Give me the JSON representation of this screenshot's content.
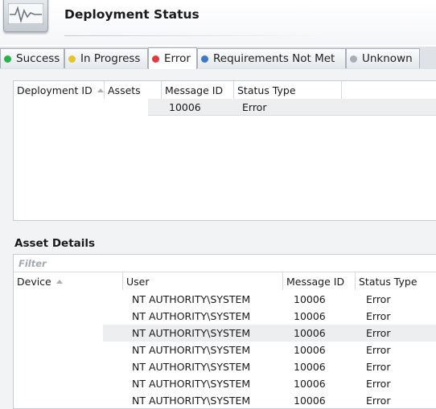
{
  "header": {
    "title": "Deployment Status",
    "icon": "activity-monitor-icon"
  },
  "tabs": [
    {
      "label": "Success",
      "color": "#2ab24a",
      "active": false
    },
    {
      "label": "In Progress",
      "color": "#e6c42b",
      "active": false
    },
    {
      "label": "Error",
      "color": "#e0393e",
      "active": true
    },
    {
      "label": "Requirements Not Met",
      "color": "#3b78c8",
      "active": false
    },
    {
      "label": "Unknown",
      "color": "#a9aeb3",
      "active": false
    }
  ],
  "deployments": {
    "columns": [
      "Deployment ID",
      "Assets",
      "Message ID",
      "Status Type"
    ],
    "sorted_column": "Deployment ID",
    "rows": [
      {
        "deployment_id": "",
        "assets": "",
        "message_id": "10006",
        "status_type": "Error"
      }
    ]
  },
  "asset_details": {
    "title": "Asset Details",
    "filter_placeholder": "Filter",
    "columns": [
      "Device",
      "User",
      "Message ID",
      "Status Type"
    ],
    "sorted_column": "Device",
    "selected_row": 2,
    "rows": [
      {
        "device": "",
        "user": "NT AUTHORITY\\SYSTEM",
        "message_id": "10006",
        "status_type": "Error"
      },
      {
        "device": "",
        "user": "NT AUTHORITY\\SYSTEM",
        "message_id": "10006",
        "status_type": "Error"
      },
      {
        "device": "",
        "user": "NT AUTHORITY\\SYSTEM",
        "message_id": "10006",
        "status_type": "Error"
      },
      {
        "device": "",
        "user": "NT AUTHORITY\\SYSTEM",
        "message_id": "10006",
        "status_type": "Error"
      },
      {
        "device": "",
        "user": "NT AUTHORITY\\SYSTEM",
        "message_id": "10006",
        "status_type": "Error"
      },
      {
        "device": "",
        "user": "NT AUTHORITY\\SYSTEM",
        "message_id": "10006",
        "status_type": "Error"
      },
      {
        "device": "",
        "user": "NT AUTHORITY\\SYSTEM",
        "message_id": "10006",
        "status_type": "Error"
      }
    ]
  }
}
